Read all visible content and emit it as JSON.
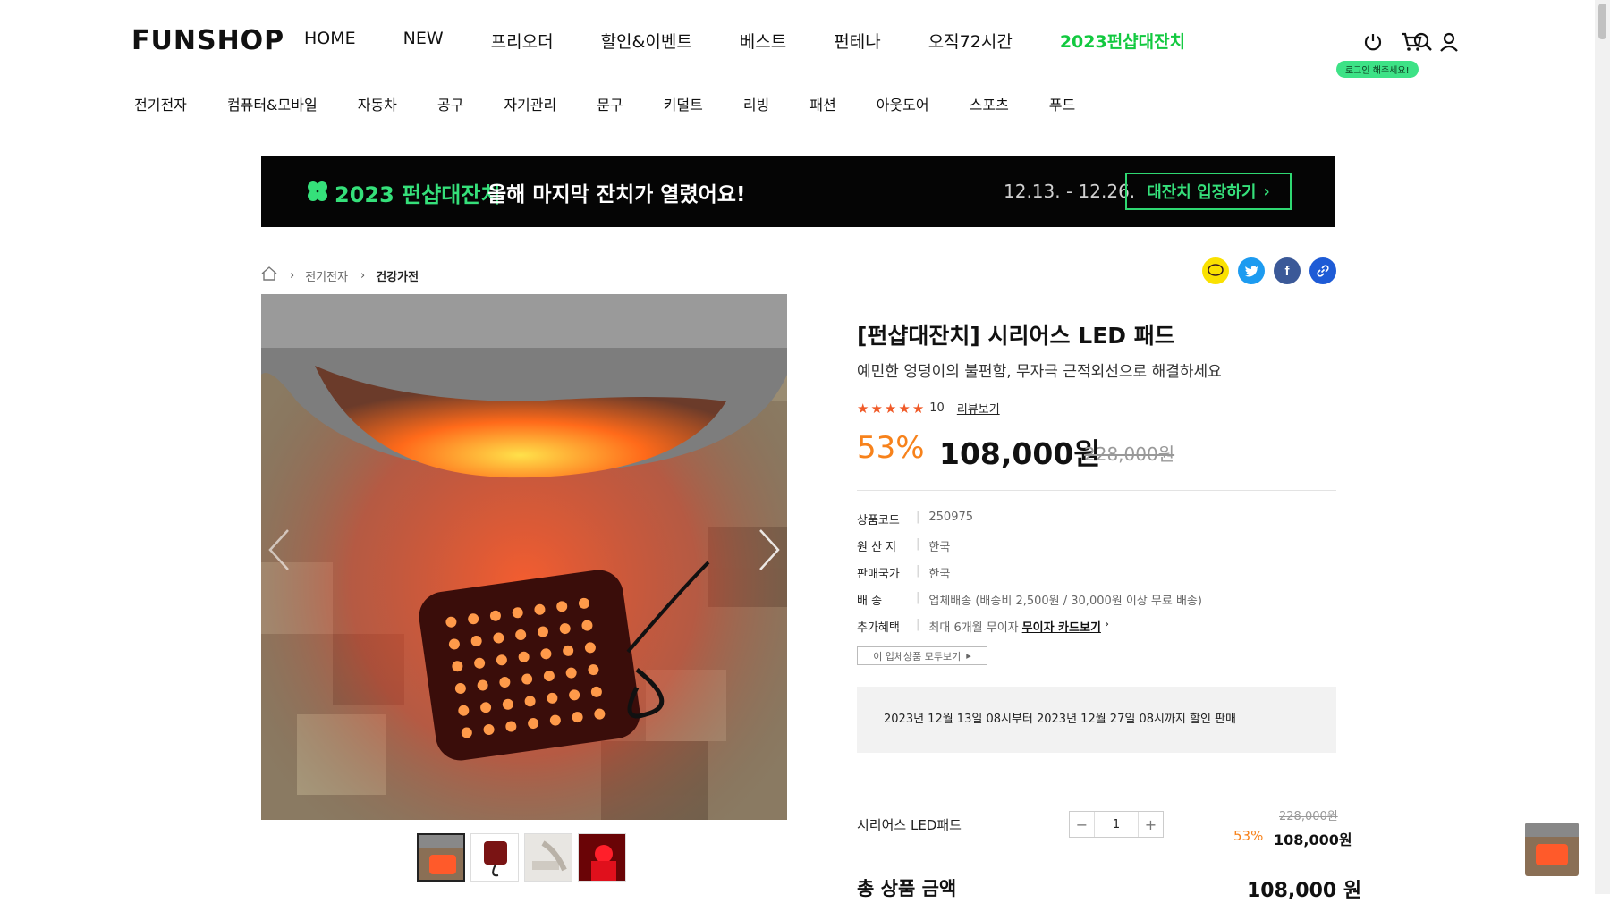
{
  "header": {
    "logo": "FUNSHOP",
    "nav": [
      "HOME",
      "NEW",
      "프리오더",
      "할인&이벤트",
      "베스트",
      "펀테나",
      "오직72시간",
      "2023펀샵대잔치"
    ],
    "login_tip": "로그인 해주세요!",
    "icons": [
      "search-icon",
      "power-icon",
      "cart-icon",
      "user-icon"
    ]
  },
  "categories": [
    "전기전자",
    "컴퓨터&모바일",
    "자동차",
    "공구",
    "자기관리",
    "문구",
    "키덜트",
    "리빙",
    "패션",
    "아웃도어",
    "스포츠",
    "푸드"
  ],
  "banner": {
    "title": "2023 펀샵대잔치",
    "message": "올해 마지막 잔치가 열렸어요!",
    "date": "12.13. - 12.26.",
    "button": "대잔치 입장하기"
  },
  "breadcrumb": {
    "level1": "전기전자",
    "level2": "건강가전"
  },
  "share_icons": [
    "kakaotalk-icon",
    "twitter-icon",
    "facebook-icon",
    "link-icon"
  ],
  "product": {
    "title": "[펀샵대잔치] 시리어스 LED 패드",
    "subtitle": "예민한 엉덩이의 불편함, 무자극 근적외선으로 해결하세요",
    "rating": 5,
    "review_count": "10",
    "review_link": "리뷰보기",
    "discount_rate": "53%",
    "price": "108,000원",
    "original_price": "228,000원"
  },
  "specs": [
    {
      "key": "상품코드",
      "value": "250975"
    },
    {
      "key": "원 산 지",
      "value": "한국"
    },
    {
      "key": "판매국가",
      "value": "한국"
    },
    {
      "key": "배 송",
      "value": "업체배송 (배송비 2,500원 / 30,000원 이상 무료 배송)"
    },
    {
      "key": "추가혜택",
      "value": "최대 6개월 무이자",
      "link": "무이자 카드보기"
    }
  ],
  "vendor_all_button": "이 업체상품 모두보기",
  "notice": "2023년 12월 13일 08시부터 2023년 12월 27일 08시까지 할인 판매",
  "option": {
    "name": "시리어스 LED패드",
    "quantity": "1",
    "original_price": "228,000원",
    "rate": "53%",
    "price": "108,000원"
  },
  "total": {
    "label": "총 상품 금액",
    "value": "108,000 원"
  }
}
